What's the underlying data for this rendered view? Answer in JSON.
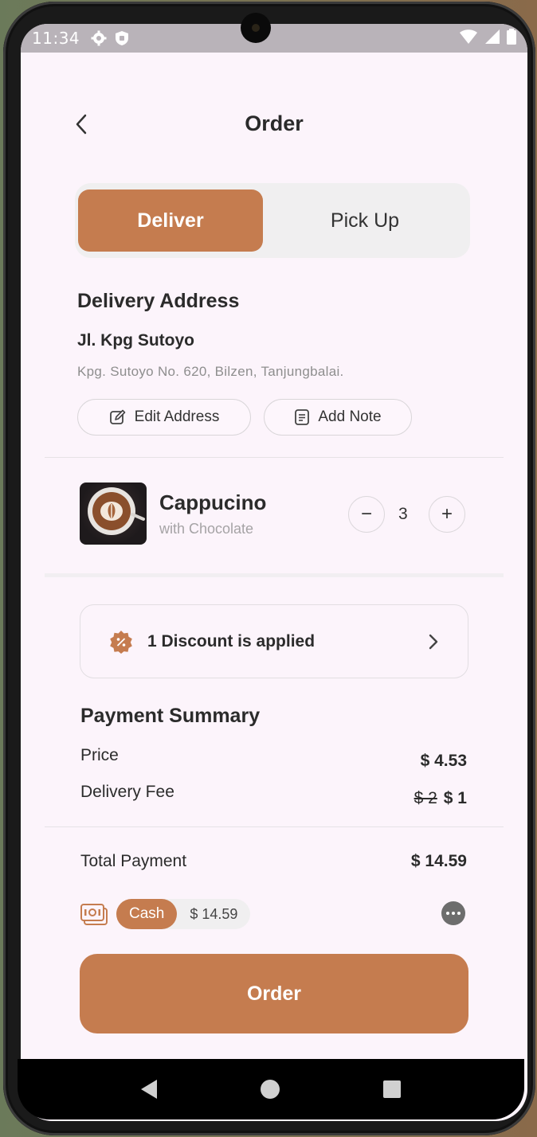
{
  "status_bar": {
    "time": "11:34"
  },
  "header": {
    "title": "Order"
  },
  "mode_toggle": {
    "options": [
      "Deliver",
      "Pick Up"
    ],
    "active": "Deliver"
  },
  "delivery": {
    "section_title": "Delivery Address",
    "name": "Jl. Kpg Sutoyo",
    "full_address": "Kpg. Sutoyo No. 620, Bilzen, Tanjungbalai.",
    "edit_label": "Edit Address",
    "note_label": "Add Note"
  },
  "item": {
    "name": "Cappucino",
    "variant": "with Chocolate",
    "quantity": "3",
    "minus": "−",
    "plus": "+"
  },
  "discount": {
    "label": "1 Discount is applied"
  },
  "summary": {
    "title": "Payment Summary",
    "price_label": "Price",
    "price_value": "$ 4.53",
    "fee_label": "Delivery Fee",
    "fee_old": "$ 2",
    "fee_new": "$ 1",
    "total_label": "Total Payment",
    "total_value": "$ 14.59"
  },
  "payment": {
    "method": "Cash",
    "amount": "$ 14.59"
  },
  "order_button": "Order",
  "colors": {
    "accent": "#c57c4f",
    "background": "#fcf4fb"
  }
}
